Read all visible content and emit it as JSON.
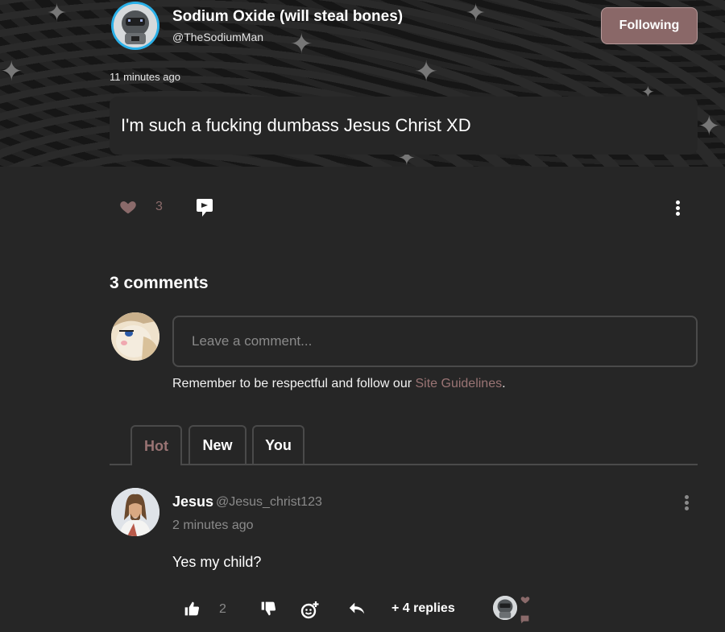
{
  "post": {
    "author_name": "Sodium Oxide (will steal bones)",
    "author_handle": "@TheSodiumMan",
    "follow_label": "Following",
    "time": "11 minutes ago",
    "text": "I'm such a fucking dumbass Jesus Christ XD",
    "likes": "3",
    "icons": {
      "like": "heart-icon",
      "share": "share-icon",
      "more": "kebab-menu-icon"
    }
  },
  "comments": {
    "title": "3 comments",
    "input_placeholder": "Leave a comment...",
    "guideline_prefix": "Remember to be respectful and follow our ",
    "guideline_link": "Site Guidelines",
    "guideline_suffix": ".",
    "tabs": [
      {
        "label": "Hot",
        "active": true
      },
      {
        "label": "New",
        "active": false
      },
      {
        "label": "You",
        "active": false
      }
    ],
    "items": [
      {
        "name": "Jesus",
        "handle": "@Jesus_christ123",
        "time": "2 minutes ago",
        "text": "Yes my child?",
        "upvotes": "2",
        "replies_label": "+ 4 replies"
      }
    ]
  },
  "colors": {
    "accent": "#8a6868",
    "link": "#9a7474",
    "background": "#262626",
    "avatar_ring": "#2ab0e8"
  }
}
